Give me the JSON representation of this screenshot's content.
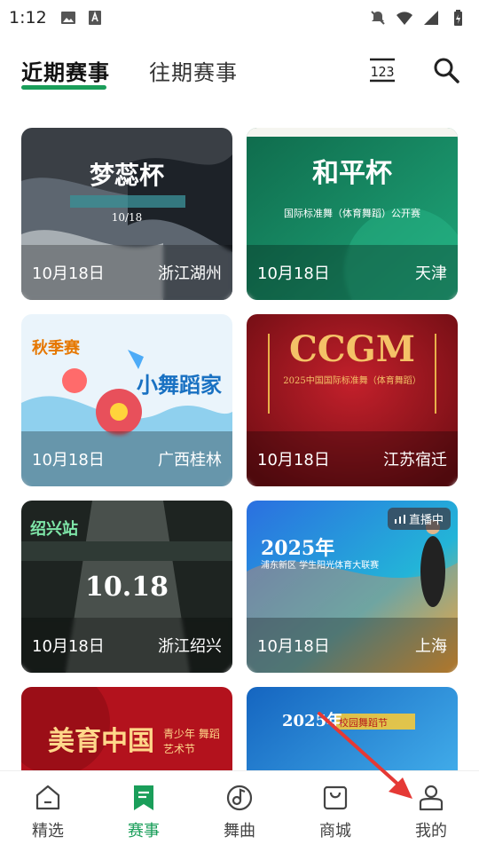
{
  "status_bar": {
    "time": "1:12"
  },
  "header": {
    "tabs": [
      {
        "label": "近期赛事",
        "active": true
      },
      {
        "label": "往期赛事",
        "active": false
      }
    ],
    "calendar_icon": "calendar-icon",
    "search_icon": "search-icon"
  },
  "events": [
    {
      "date": "10月18日",
      "location": "浙江湖州",
      "poster_title": "梦蕊杯",
      "poster_sub": "10/18",
      "theme": "dark-wave"
    },
    {
      "date": "10月18日",
      "location": "天津",
      "poster_title": "和平杯",
      "poster_sub": "国际标准舞（体育舞蹈）公开赛",
      "theme": "green"
    },
    {
      "date": "10月18日",
      "location": "广西桂林",
      "poster_title": "秋季赛",
      "poster_sub": "小舞蹈家",
      "theme": "bright"
    },
    {
      "date": "10月18日",
      "location": "江苏宿迁",
      "poster_title": "CCGM",
      "poster_sub": "2025中国国际标准舞（体育舞蹈）",
      "theme": "red"
    },
    {
      "date": "10月18日",
      "location": "浙江绍兴",
      "poster_title": "绍兴站",
      "poster_sub": "10.18",
      "theme": "dark"
    },
    {
      "date": "10月18日",
      "location": "上海",
      "poster_title": "2025年",
      "poster_sub": "浦东新区 学生阳光体育大联赛",
      "theme": "blue",
      "live_label": "直播中"
    },
    {
      "date": "",
      "location": "",
      "poster_title": "美育中国",
      "poster_sub": "青少年 舞蹈艺术节",
      "theme": "crimson"
    },
    {
      "date": "",
      "location": "",
      "poster_title": "2025年",
      "poster_sub": "校园舞蹈节",
      "theme": "blue2"
    }
  ],
  "bottom_nav": [
    {
      "label": "精选",
      "icon": "home-icon",
      "active": false
    },
    {
      "label": "赛事",
      "icon": "event-icon",
      "active": true
    },
    {
      "label": "舞曲",
      "icon": "music-icon",
      "active": false
    },
    {
      "label": "商城",
      "icon": "shopping-bag-icon",
      "active": false
    },
    {
      "label": "我的",
      "icon": "profile-icon",
      "active": false
    }
  ],
  "colors": {
    "accent": "#1a9e5a",
    "annotation": "#e53935"
  }
}
